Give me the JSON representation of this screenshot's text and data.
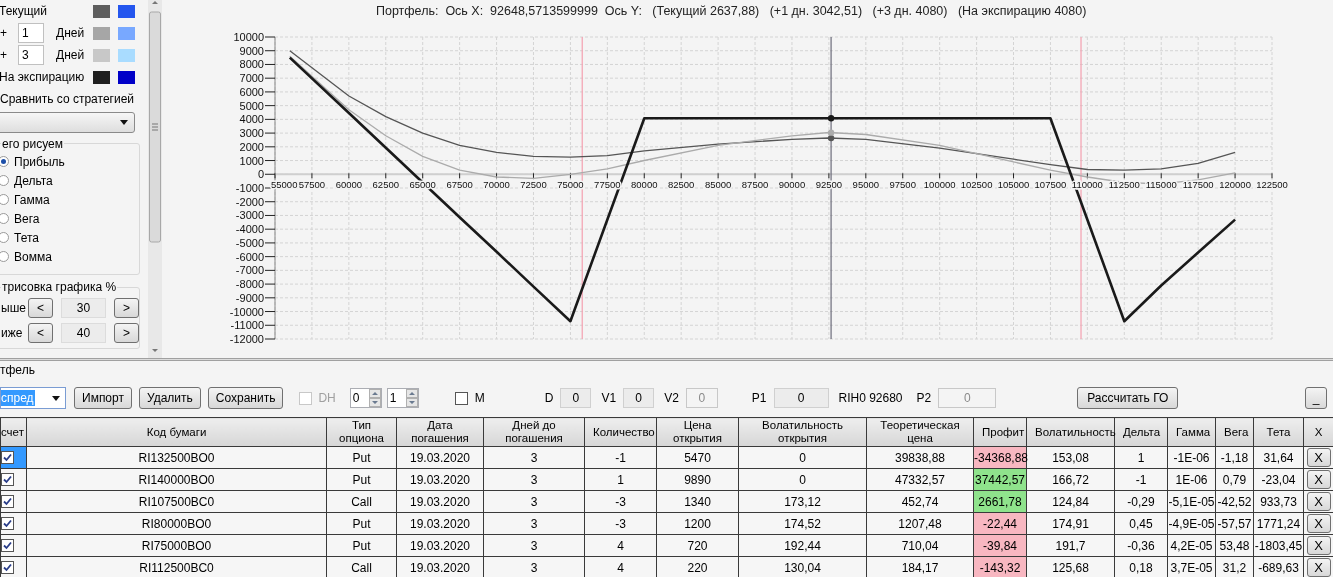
{
  "legend": [
    {
      "kind": "plain",
      "label": "Текущий",
      "swatches": [
        {
          "color": "#5e5e5e"
        },
        {
          "color": "#2456ee"
        }
      ]
    },
    {
      "kind": "offset",
      "sign": "+",
      "days": "1",
      "unit": "Дней",
      "swatches": [
        {
          "color": "#a6a6a6"
        },
        {
          "color": "#78a8ff"
        }
      ]
    },
    {
      "kind": "offset",
      "sign": "+",
      "days": "3",
      "unit": "Дней",
      "swatches": [
        {
          "color": "#c8c8c8"
        },
        {
          "color": "#a9dcff"
        }
      ]
    },
    {
      "kind": "plain",
      "label": "На экспирацию",
      "swatches": [
        {
          "color": "#1f1f1f"
        },
        {
          "color": "#0000c8"
        }
      ]
    }
  ],
  "compare": {
    "label": "Сравнить со стратегией"
  },
  "plot_group": {
    "title": "его рисуем",
    "options": [
      {
        "label": "Прибыль",
        "selected": true
      },
      {
        "label": "Дельта",
        "selected": false
      },
      {
        "label": "Гамма",
        "selected": false
      },
      {
        "label": "Вега",
        "selected": false
      },
      {
        "label": "Тета",
        "selected": false
      },
      {
        "label": "Вомма",
        "selected": false
      }
    ]
  },
  "range_group": {
    "title": "трисовка графика %",
    "rows": [
      {
        "label": "ыше",
        "prev": "<",
        "value": "30",
        "next": ">"
      },
      {
        "label": "иже",
        "prev": "<",
        "value": "40",
        "next": ">"
      }
    ]
  },
  "chart": {
    "title": "Портфель:  Ось X:  92648,5713599999  Ось Y:   (Текущий 2637,88)   (+1 дн. 3042,51)   (+3 дн. 4080)   (На экспирацию 4080)",
    "chart_data": {
      "type": "line",
      "x": [
        56000,
        60000,
        62500,
        65000,
        67500,
        70000,
        72500,
        75000,
        77500,
        80000,
        85000,
        90000,
        92500,
        95000,
        100000,
        105000,
        107500,
        110000,
        112500,
        115000,
        117500,
        120000
      ],
      "series": [
        {
          "color": "#555555",
          "values": [
            9000,
            5700,
            4200,
            3000,
            2100,
            1600,
            1300,
            1250,
            1350,
            1700,
            2200,
            2550,
            2640,
            2550,
            1900,
            1100,
            700,
            350,
            300,
            400,
            800,
            1600
          ]
        },
        {
          "color": "#ababab",
          "values": [
            8600,
            4700,
            2800,
            1300,
            300,
            -200,
            -300,
            0,
            400,
            1000,
            2100,
            2800,
            3040,
            2900,
            2100,
            900,
            300,
            -200,
            -600,
            -700,
            -400,
            100
          ]
        },
        {
          "color": "#1a1a1a",
          "values": [
            8500,
            4460,
            1930,
            -600,
            -3130,
            -5650,
            -8180,
            -10700,
            -3310,
            4080,
            4080,
            4080,
            4080,
            4080,
            4080,
            4080,
            4080,
            -3310,
            -10700,
            -8100,
            -5700,
            -3300
          ]
        }
      ],
      "xlim": [
        55000,
        122500
      ],
      "ylim": [
        -12000,
        10000
      ],
      "xticks": [
        55000,
        57500,
        60000,
        62500,
        65000,
        67500,
        70000,
        72500,
        75000,
        77500,
        80000,
        82500,
        85000,
        87500,
        90000,
        92500,
        95000,
        97500,
        100000,
        102500,
        105000,
        107500,
        110000,
        112500,
        115000,
        117500,
        120000,
        122500
      ],
      "yticks": [
        -12000,
        -11000,
        -10000,
        -9000,
        -8000,
        -7000,
        -6000,
        -5000,
        -4000,
        -3000,
        -2000,
        -1000,
        0,
        1000,
        2000,
        3000,
        4000,
        5000,
        6000,
        7000,
        8000,
        9000,
        10000
      ],
      "grid": true,
      "ref_lines": [
        {
          "axis": "x",
          "value": 75800,
          "color": "#f4a0b0"
        },
        {
          "axis": "x",
          "value": 109570,
          "color": "#f4a0b0"
        },
        {
          "axis": "x",
          "value": 92648.57,
          "color": "#6a6a7a"
        }
      ]
    }
  },
  "portfolio": {
    "title": "тфель",
    "strategy": "спред",
    "buttons": [
      "Импорт",
      "Удалить",
      "Сохранить"
    ],
    "dh": {
      "label": "DH",
      "checked": false,
      "disabled": true
    },
    "spinners": [
      "0",
      "1"
    ],
    "m": {
      "label": "M",
      "checked": false
    },
    "fields": [
      {
        "kind": "field",
        "label": "D",
        "value": "0",
        "disabled": false
      },
      {
        "kind": "field",
        "label": "V1",
        "value": "0",
        "disabled": false
      },
      {
        "kind": "field",
        "label": "V2",
        "value": "0",
        "disabled": true
      },
      {
        "kind": "field",
        "label": "P1",
        "value": "0",
        "disabled": false
      },
      {
        "kind": "text",
        "label": "RIH0 92680"
      },
      {
        "kind": "field",
        "label": "P2",
        "value": "0",
        "disabled": true
      }
    ],
    "calc_button": "Рассчитать ГО",
    "minimize_button": "_"
  },
  "table": {
    "columns": [
      "счет",
      "Код бумаги",
      "Тип опциона",
      "Дата погашения",
      "Дней до погашения",
      "Количество",
      "Цена открытия",
      "Волатильность открытия",
      "Теоретическая цена",
      "Профит",
      "Волатильность",
      "Дельта",
      "Гамма",
      "Вега",
      "Тета",
      "X"
    ],
    "rows": [
      {
        "checked": true,
        "selected": true,
        "color": "#f8b7c1",
        "delete": "X",
        "cells": [
          "",
          "RI132500BO0",
          "Put",
          "19.03.2020",
          "3",
          "-1",
          "5470",
          "0",
          "39838,88",
          "-34368,88",
          "153,08",
          "1",
          "-1E-06",
          "-1,18",
          "31,64"
        ]
      },
      {
        "checked": true,
        "selected": false,
        "color": "#8fe38c",
        "delete": "X",
        "cells": [
          "",
          "RI140000BO0",
          "Put",
          "19.03.2020",
          "3",
          "1",
          "9890",
          "0",
          "47332,57",
          "37442,57",
          "166,72",
          "-1",
          "1E-06",
          "0,79",
          "-23,04"
        ]
      },
      {
        "checked": true,
        "selected": false,
        "color": "#8fe38c",
        "delete": "X",
        "cells": [
          "",
          "RI107500BC0",
          "Call",
          "19.03.2020",
          "3",
          "-3",
          "1340",
          "173,12",
          "452,74",
          "2661,78",
          "124,84",
          "-0,29",
          "-5,1E-05",
          "-42,52",
          "933,73"
        ]
      },
      {
        "checked": true,
        "selected": false,
        "color": "#f8b7c1",
        "delete": "X",
        "cells": [
          "",
          "RI80000BO0",
          "Put",
          "19.03.2020",
          "3",
          "-3",
          "1200",
          "174,52",
          "1207,48",
          "-22,44",
          "174,91",
          "0,45",
          "-4,9E-05",
          "-57,57",
          "1771,24"
        ]
      },
      {
        "checked": true,
        "selected": false,
        "color": "#f8b7c1",
        "delete": "X",
        "cells": [
          "",
          "RI75000BO0",
          "Put",
          "19.03.2020",
          "3",
          "4",
          "720",
          "192,44",
          "710,04",
          "-39,84",
          "191,7",
          "-0,36",
          "4,2E-05",
          "53,48",
          "-1803,45"
        ]
      },
      {
        "checked": true,
        "selected": false,
        "color": "#f8b7c1",
        "delete": "X",
        "cells": [
          "",
          "RI112500BC0",
          "Call",
          "19.03.2020",
          "3",
          "4",
          "220",
          "130,04",
          "184,17",
          "-143,32",
          "125,68",
          "0,18",
          "3,7E-05",
          "31,2",
          "-689,63"
        ]
      }
    ]
  }
}
